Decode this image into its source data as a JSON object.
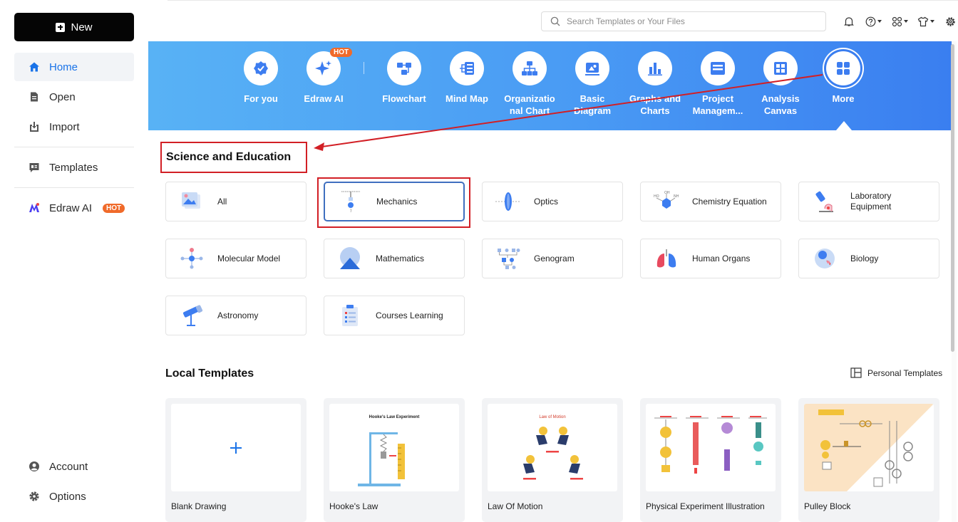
{
  "sidebar": {
    "new_label": "New",
    "items": [
      {
        "label": "Home",
        "icon": "home-icon"
      },
      {
        "label": "Open",
        "icon": "open-file-icon"
      },
      {
        "label": "Import",
        "icon": "import-icon"
      },
      {
        "label": "Templates",
        "icon": "templates-icon"
      },
      {
        "label": "Edraw AI",
        "icon": "edraw-ai-icon",
        "badge": "HOT"
      }
    ],
    "bottom": [
      {
        "label": "Account",
        "icon": "account-icon"
      },
      {
        "label": "Options",
        "icon": "gear-icon"
      }
    ]
  },
  "search": {
    "placeholder": "Search Templates or Your Files"
  },
  "categories": [
    {
      "label": "For you"
    },
    {
      "label": "Edraw AI",
      "badge": "HOT"
    },
    {
      "label": "Flowchart"
    },
    {
      "label": "Mind Map"
    },
    {
      "label": "Organizatio nal Chart"
    },
    {
      "label": "Basic Diagram"
    },
    {
      "label": "Graphs and Charts"
    },
    {
      "label": "Project Managem..."
    },
    {
      "label": "Analysis Canvas"
    },
    {
      "label": "More"
    }
  ],
  "section_title": "Science and Education",
  "subcategories": [
    "All",
    "Mechanics",
    "Optics",
    "Chemistry Equation",
    "Laboratory Equipment",
    "Molecular Model",
    "Mathematics",
    "Genogram",
    "Human Organs",
    "Biology",
    "Astronomy",
    "Courses Learning"
  ],
  "local_templates": {
    "title": "Local Templates",
    "personal_label": "Personal Templates",
    "cards": [
      {
        "name": "Blank Drawing"
      },
      {
        "name": "Hooke's Law",
        "thumb_title": "Hooke's Law Experiment"
      },
      {
        "name": "Law Of Motion",
        "thumb_title": "Law of Motion"
      },
      {
        "name": "Physical Experiment Illustration"
      },
      {
        "name": "Pulley Block"
      }
    ]
  },
  "colors": {
    "accent": "#1a73e8",
    "banner": "#4a9cf4",
    "highlight": "#d21f25",
    "hot": "#f06a2a"
  }
}
